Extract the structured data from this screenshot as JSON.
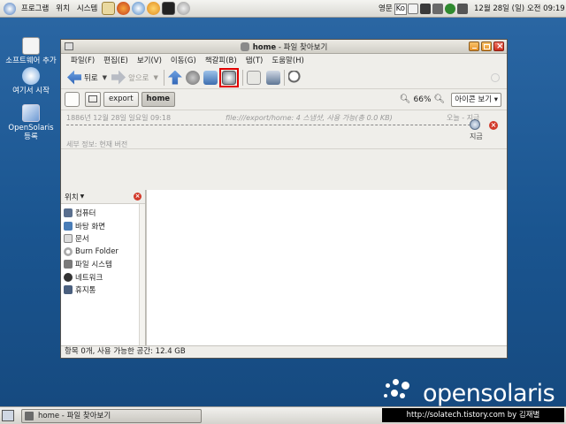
{
  "top_panel": {
    "menus": [
      "프로그램",
      "위치",
      "시스템"
    ],
    "lang": "영문",
    "ime": "Ko",
    "clock": "12월 28일 (일) 오전 09:19"
  },
  "desktop": {
    "icons": [
      {
        "label": "소프트웨어 추가",
        "icon": "software-add-icon"
      },
      {
        "label": "여기서 시작",
        "icon": "start-here-icon"
      },
      {
        "label": "OpenSolaris 등록",
        "icon": "opensolaris-register-icon"
      }
    ],
    "brand": "opensolaris"
  },
  "window": {
    "title_bold": "home",
    "title_rest": " - 파일 찾아보기",
    "menubar": [
      "파일(F)",
      "편집(E)",
      "보기(V)",
      "이동(G)",
      "책갈피(B)",
      "탭(T)",
      "도움말(H)"
    ],
    "toolbar": {
      "back": "뒤로",
      "forward": "앞으로"
    },
    "location": {
      "crumbs": [
        "export",
        "home"
      ],
      "zoom": "66%",
      "view": "아이콘 보기"
    },
    "timeslider": {
      "date": "1886년 12월 28일 일요일 09:18",
      "uri": "file:///export/home: 4 스냅샷, 사용 가능(총 0.0 KB)",
      "now_label": "오늘 - 지금",
      "current": "지금",
      "detail": "세부 정보: 현재 버전"
    },
    "sidebar": {
      "header": "위치",
      "places": [
        {
          "label": "컴퓨터",
          "icon": "computer-icon",
          "color": "#5a6f8e"
        },
        {
          "label": "바탕 화면",
          "icon": "desktop-icon",
          "color": "#4a7db7"
        },
        {
          "label": "문서",
          "icon": "document-icon",
          "color": "#dcdcdc"
        },
        {
          "label": "Burn Folder",
          "icon": "burn-folder-icon",
          "color": "#c9c9c9"
        },
        {
          "label": "파일 시스템",
          "icon": "filesystem-icon",
          "color": "#7a7a7a"
        },
        {
          "label": "네트워크",
          "icon": "network-icon",
          "color": "#333333"
        },
        {
          "label": "휴지통",
          "icon": "trash-icon",
          "color": "#4a5f7e"
        }
      ]
    },
    "status": "항목 0개, 사용 가능한 공간: 12.4 GB"
  },
  "bottom_panel": {
    "task": "home - 파일 찾아보기",
    "watermark": "http://solatech.tistory.com by 김재별"
  }
}
